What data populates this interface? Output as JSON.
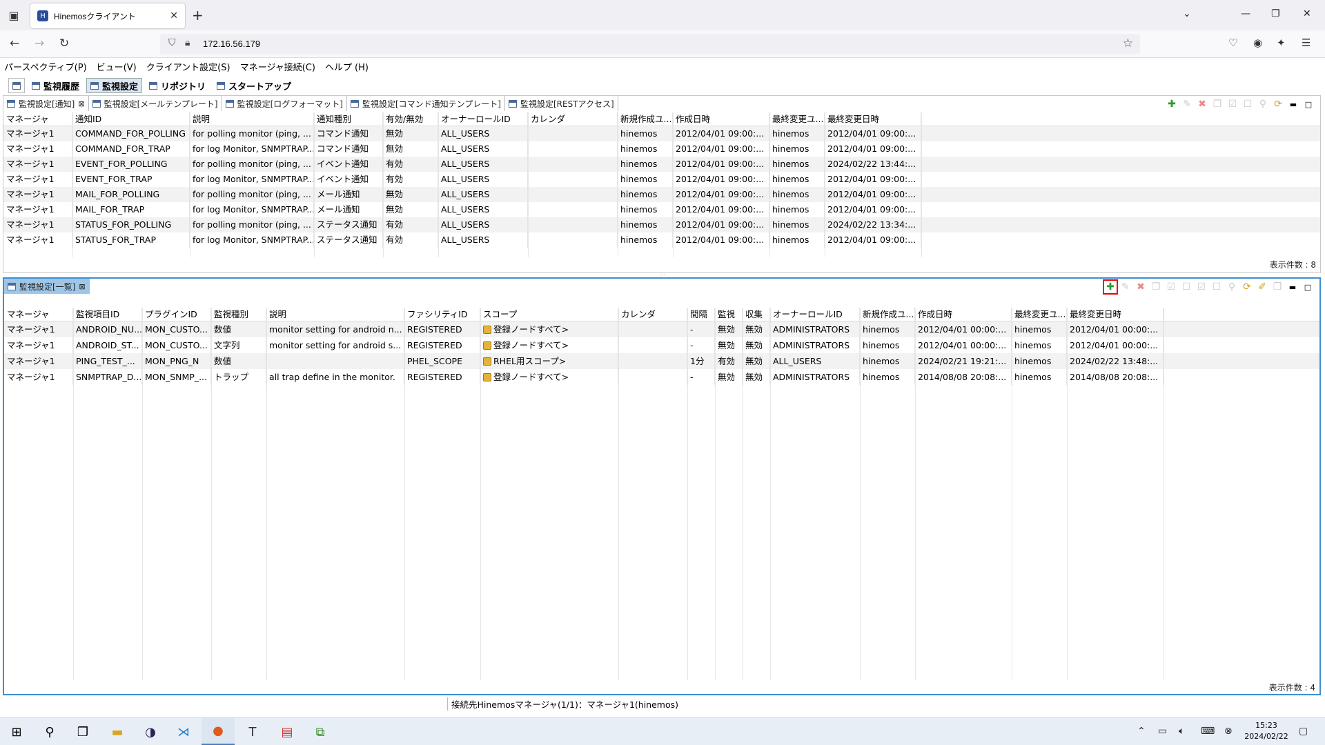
{
  "browser": {
    "tab_title": "Hinemosクライアント",
    "url": "172.16.56.179"
  },
  "menu": [
    "パースペクティブ(P)",
    "ビュー(V)",
    "クライアント設定(S)",
    "マネージャ接続(C)",
    "ヘルプ (H)"
  ],
  "perspectives": [
    "監視履歴",
    "監視設定",
    "リポジトリ",
    "スタートアップ"
  ],
  "pane1": {
    "tabs": [
      "監視設定[通知]",
      "監視設定[メールテンプレート]",
      "監視設定[ログフォーマット]",
      "監視設定[コマンド通知テンプレート]",
      "監視設定[RESTアクセス]"
    ],
    "columns": [
      "マネージャ",
      "通知ID",
      "説明",
      "通知種別",
      "有効/無効",
      "オーナーロールID",
      "カレンダ",
      "新規作成ユ...",
      "作成日時",
      "最終変更ユ...",
      "最終変更日時"
    ],
    "rows": [
      [
        "マネージャ1",
        "COMMAND_FOR_POLLING",
        "for polling monitor (ping, ...",
        "コマンド通知",
        "無効",
        "ALL_USERS",
        "",
        "hinemos",
        "2012/04/01 09:00:...",
        "hinemos",
        "2012/04/01 09:00:..."
      ],
      [
        "マネージャ1",
        "COMMAND_FOR_TRAP",
        "for log Monitor, SNMPTRAP...",
        "コマンド通知",
        "無効",
        "ALL_USERS",
        "",
        "hinemos",
        "2012/04/01 09:00:...",
        "hinemos",
        "2012/04/01 09:00:..."
      ],
      [
        "マネージャ1",
        "EVENT_FOR_POLLING",
        "for polling monitor (ping, ...",
        "イベント通知",
        "有効",
        "ALL_USERS",
        "",
        "hinemos",
        "2012/04/01 09:00:...",
        "hinemos",
        "2024/02/22 13:44:..."
      ],
      [
        "マネージャ1",
        "EVENT_FOR_TRAP",
        "for log Monitor, SNMPTRAP...",
        "イベント通知",
        "有効",
        "ALL_USERS",
        "",
        "hinemos",
        "2012/04/01 09:00:...",
        "hinemos",
        "2012/04/01 09:00:..."
      ],
      [
        "マネージャ1",
        "MAIL_FOR_POLLING",
        "for polling monitor (ping, ...",
        "メール通知",
        "無効",
        "ALL_USERS",
        "",
        "hinemos",
        "2012/04/01 09:00:...",
        "hinemos",
        "2012/04/01 09:00:..."
      ],
      [
        "マネージャ1",
        "MAIL_FOR_TRAP",
        "for log Monitor, SNMPTRAP...",
        "メール通知",
        "無効",
        "ALL_USERS",
        "",
        "hinemos",
        "2012/04/01 09:00:...",
        "hinemos",
        "2012/04/01 09:00:..."
      ],
      [
        "マネージャ1",
        "STATUS_FOR_POLLING",
        "for polling monitor (ping, ...",
        "ステータス通知",
        "有効",
        "ALL_USERS",
        "",
        "hinemos",
        "2012/04/01 09:00:...",
        "hinemos",
        "2024/02/22 13:34:..."
      ],
      [
        "マネージャ1",
        "STATUS_FOR_TRAP",
        "for log Monitor, SNMPTRAP...",
        "ステータス通知",
        "有効",
        "ALL_USERS",
        "",
        "hinemos",
        "2012/04/01 09:00:...",
        "hinemos",
        "2012/04/01 09:00:..."
      ]
    ],
    "count": "表示件数 : 8"
  },
  "pane2": {
    "tab": "監視設定[一覧]",
    "columns": [
      "マネージャ",
      "監視項目ID",
      "プラグインID",
      "監視種別",
      "説明",
      "ファシリティID",
      "スコープ",
      "カレンダ",
      "間隔",
      "監視",
      "収集",
      "オーナーロールID",
      "新規作成ユ...",
      "作成日時",
      "最終変更ユ...",
      "最終変更日時"
    ],
    "rows": [
      [
        "マネージャ1",
        "ANDROID_NU...",
        "MON_CUSTO...",
        "数値",
        "monitor setting for android n...",
        "REGISTERED",
        "登録ノードすべて>",
        "",
        "-",
        "無効",
        "無効",
        "ADMINISTRATORS",
        "hinemos",
        "2012/04/01 00:00:...",
        "hinemos",
        "2012/04/01 00:00:..."
      ],
      [
        "マネージャ1",
        "ANDROID_ST...",
        "MON_CUSTO...",
        "文字列",
        "monitor setting for android s...",
        "REGISTERED",
        "登録ノードすべて>",
        "",
        "-",
        "無効",
        "無効",
        "ADMINISTRATORS",
        "hinemos",
        "2012/04/01 00:00:...",
        "hinemos",
        "2012/04/01 00:00:..."
      ],
      [
        "マネージャ1",
        "PING_TEST_...",
        "MON_PNG_N",
        "数値",
        "",
        "PHEL_SCOPE",
        "RHEL用スコープ>",
        "",
        "1分",
        "有効",
        "無効",
        "ALL_USERS",
        "hinemos",
        "2024/02/21 19:21:...",
        "hinemos",
        "2024/02/22 13:48:..."
      ],
      [
        "マネージャ1",
        "SNMPTRAP_D...",
        "MON_SNMP_...",
        "トラップ",
        "all trap define in the monitor.",
        "REGISTERED",
        "登録ノードすべて>",
        "",
        "-",
        "無効",
        "無効",
        "ADMINISTRATORS",
        "hinemos",
        "2014/08/08 20:08:...",
        "hinemos",
        "2014/08/08 20:08:..."
      ]
    ],
    "count": "表示件数 : 4"
  },
  "status": "接続先Hinemosマネージャ(1/1)：マネージャ1(hinemos)",
  "clock": {
    "time": "15:23",
    "date": "2024/02/22"
  }
}
